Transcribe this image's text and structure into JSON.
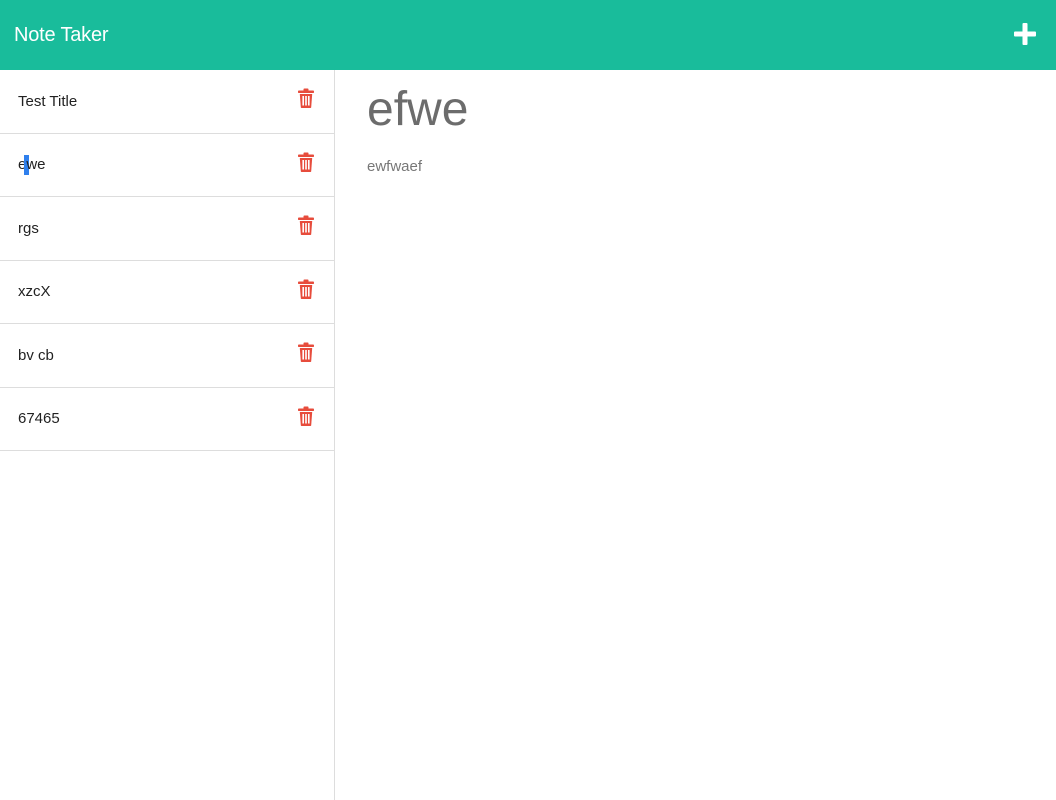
{
  "navbar": {
    "brand": "Note Taker",
    "add_icon": "plus-icon"
  },
  "notes": [
    {
      "title": "Test Title",
      "icon": "trash-icon"
    },
    {
      "title_before": "e",
      "title_after": "we",
      "icon": "trash-icon"
    },
    {
      "title": "rgs",
      "icon": "trash-icon"
    },
    {
      "title": "xzcX",
      "icon": "trash-icon"
    },
    {
      "title": "bv cb",
      "icon": "trash-icon"
    },
    {
      "title": "67465",
      "icon": "trash-icon"
    }
  ],
  "active_note": {
    "title": "efwe",
    "text": "ewfwaef"
  },
  "colors": {
    "navbar": "#19bc9b",
    "trash": "#e74c3c",
    "heading": "#6c6c6c"
  }
}
